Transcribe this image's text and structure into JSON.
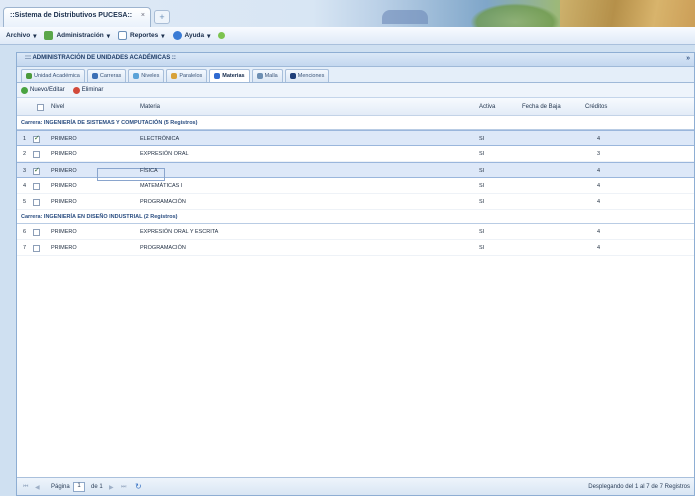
{
  "browser": {
    "tab_title": "::Sistema de Distributivos PUCESA::",
    "tab_close": "×",
    "new_tab": "+"
  },
  "menubar": {
    "items": [
      "Archivo",
      "Administración",
      "Reportes",
      "Ayuda"
    ]
  },
  "panel": {
    "title": "::: ADMINISTRACIÓN DE UNIDADES ACADÉMICAS ::",
    "tool": "»",
    "tabs": [
      "Unidad Académica",
      "Carreras",
      "Niveles",
      "Paralelos",
      "Materias",
      "Malla",
      "Menciones"
    ],
    "active_tab_index": 4,
    "toolbar": {
      "new_edit": "Nuevo/Editar",
      "delete": "Eliminar"
    },
    "columns": {
      "nivel": "Nivel",
      "materia": "Materia",
      "activa": "Activa",
      "fecha_baja": "Fecha de Baja",
      "creditos": "Créditos"
    },
    "groups": [
      {
        "label": "Carrera: INGENIERÍA DE SISTEMAS Y COMPUTACIÓN (5 Registros)",
        "rows": [
          {
            "num": "1",
            "nivel": "PRIMERO",
            "materia": "ELECTRÓNICA",
            "activa": "SI",
            "creditos": "4",
            "checked": true,
            "selected": true
          },
          {
            "num": "2",
            "nivel": "PRIMERO",
            "materia": "EXPRESIÓN ORAL",
            "activa": "SI",
            "creditos": "3",
            "checked": false,
            "selected": false
          },
          {
            "num": "3",
            "nivel": "PRIMERO",
            "materia": "FÍSICA",
            "activa": "SI",
            "creditos": "4",
            "checked": true,
            "selected": true
          },
          {
            "num": "4",
            "nivel": "PRIMERO",
            "materia": "MATEMÁTICAS I",
            "activa": "SI",
            "creditos": "4",
            "checked": false,
            "selected": false
          },
          {
            "num": "5",
            "nivel": "PRIMERO",
            "materia": "PROGRAMACIÓN",
            "activa": "SI",
            "creditos": "4",
            "checked": false,
            "selected": false
          }
        ]
      },
      {
        "label": "Carrera: INGENIERÍA EN DISEÑO INDUSTRIAL (2 Registros)",
        "rows": [
          {
            "num": "6",
            "nivel": "PRIMERO",
            "materia": "EXPRESIÓN ORAL Y ESCRITA",
            "activa": "SI",
            "creditos": "4",
            "checked": false,
            "selected": false
          },
          {
            "num": "7",
            "nivel": "PRIMERO",
            "materia": "PROGRAMACIÓN",
            "activa": "SI",
            "creditos": "4",
            "checked": false,
            "selected": false
          }
        ]
      }
    ],
    "footer": {
      "page_label": "Página",
      "page_value": "1",
      "of_label": "de 1",
      "status": "Desplegando del 1 al 7 de 7 Registros"
    }
  },
  "colors": {
    "accent": "#2a4d80",
    "selected_row": "#dde8f8",
    "panel_border": "#8eaed3"
  }
}
